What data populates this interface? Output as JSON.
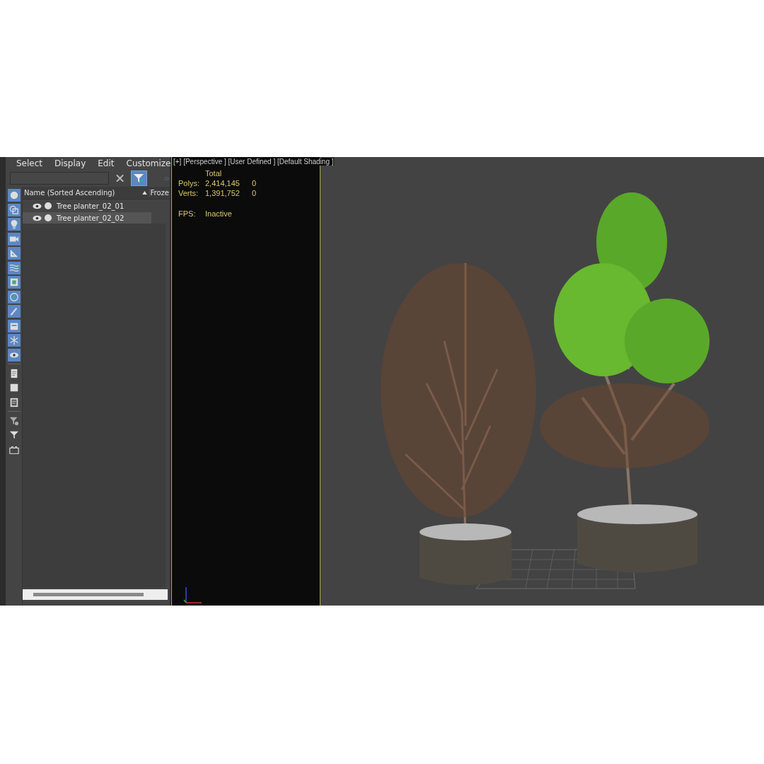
{
  "menu": [
    "Select",
    "Display",
    "Edit",
    "Customize"
  ],
  "toolbar": [
    {
      "kind": "geometry",
      "on": true
    },
    {
      "kind": "shapes",
      "on": true
    },
    {
      "kind": "lights",
      "on": true
    },
    {
      "kind": "cameras",
      "on": true
    },
    {
      "kind": "helpers",
      "on": true
    },
    {
      "kind": "spacewarps",
      "on": true
    },
    {
      "kind": "groups",
      "on": true
    },
    {
      "kind": "xrefs",
      "on": true
    },
    {
      "kind": "bones",
      "on": true
    },
    {
      "kind": "containers",
      "on": true
    },
    {
      "kind": "frozen",
      "on": true
    },
    {
      "kind": "hidden",
      "on": true
    },
    {
      "kind": "doc",
      "on": false
    },
    {
      "kind": "square",
      "on": false
    },
    {
      "kind": "doc2",
      "on": false
    },
    {
      "kind": "filtergear",
      "on": false
    },
    {
      "kind": "filter",
      "on": false
    },
    {
      "kind": "layers",
      "on": false
    }
  ],
  "columns": [
    "Name (Sorted Ascending)",
    "Froze"
  ],
  "rows": [
    {
      "name": "Tree planter_02_01",
      "selected": false
    },
    {
      "name": "Tree planter_02_02",
      "selected": true
    }
  ],
  "viewport": {
    "label": "[+] [Perspective ] [User Defined ] [Default Shading ]",
    "stats": {
      "header": "Total",
      "rows": [
        {
          "label": "Polys:",
          "total": "2,414,145",
          "selected": "0"
        },
        {
          "label": "Verts:",
          "total": "1,391,752",
          "selected": "0"
        }
      ],
      "fps_label": "FPS:",
      "fps_value": "Inactive"
    }
  }
}
